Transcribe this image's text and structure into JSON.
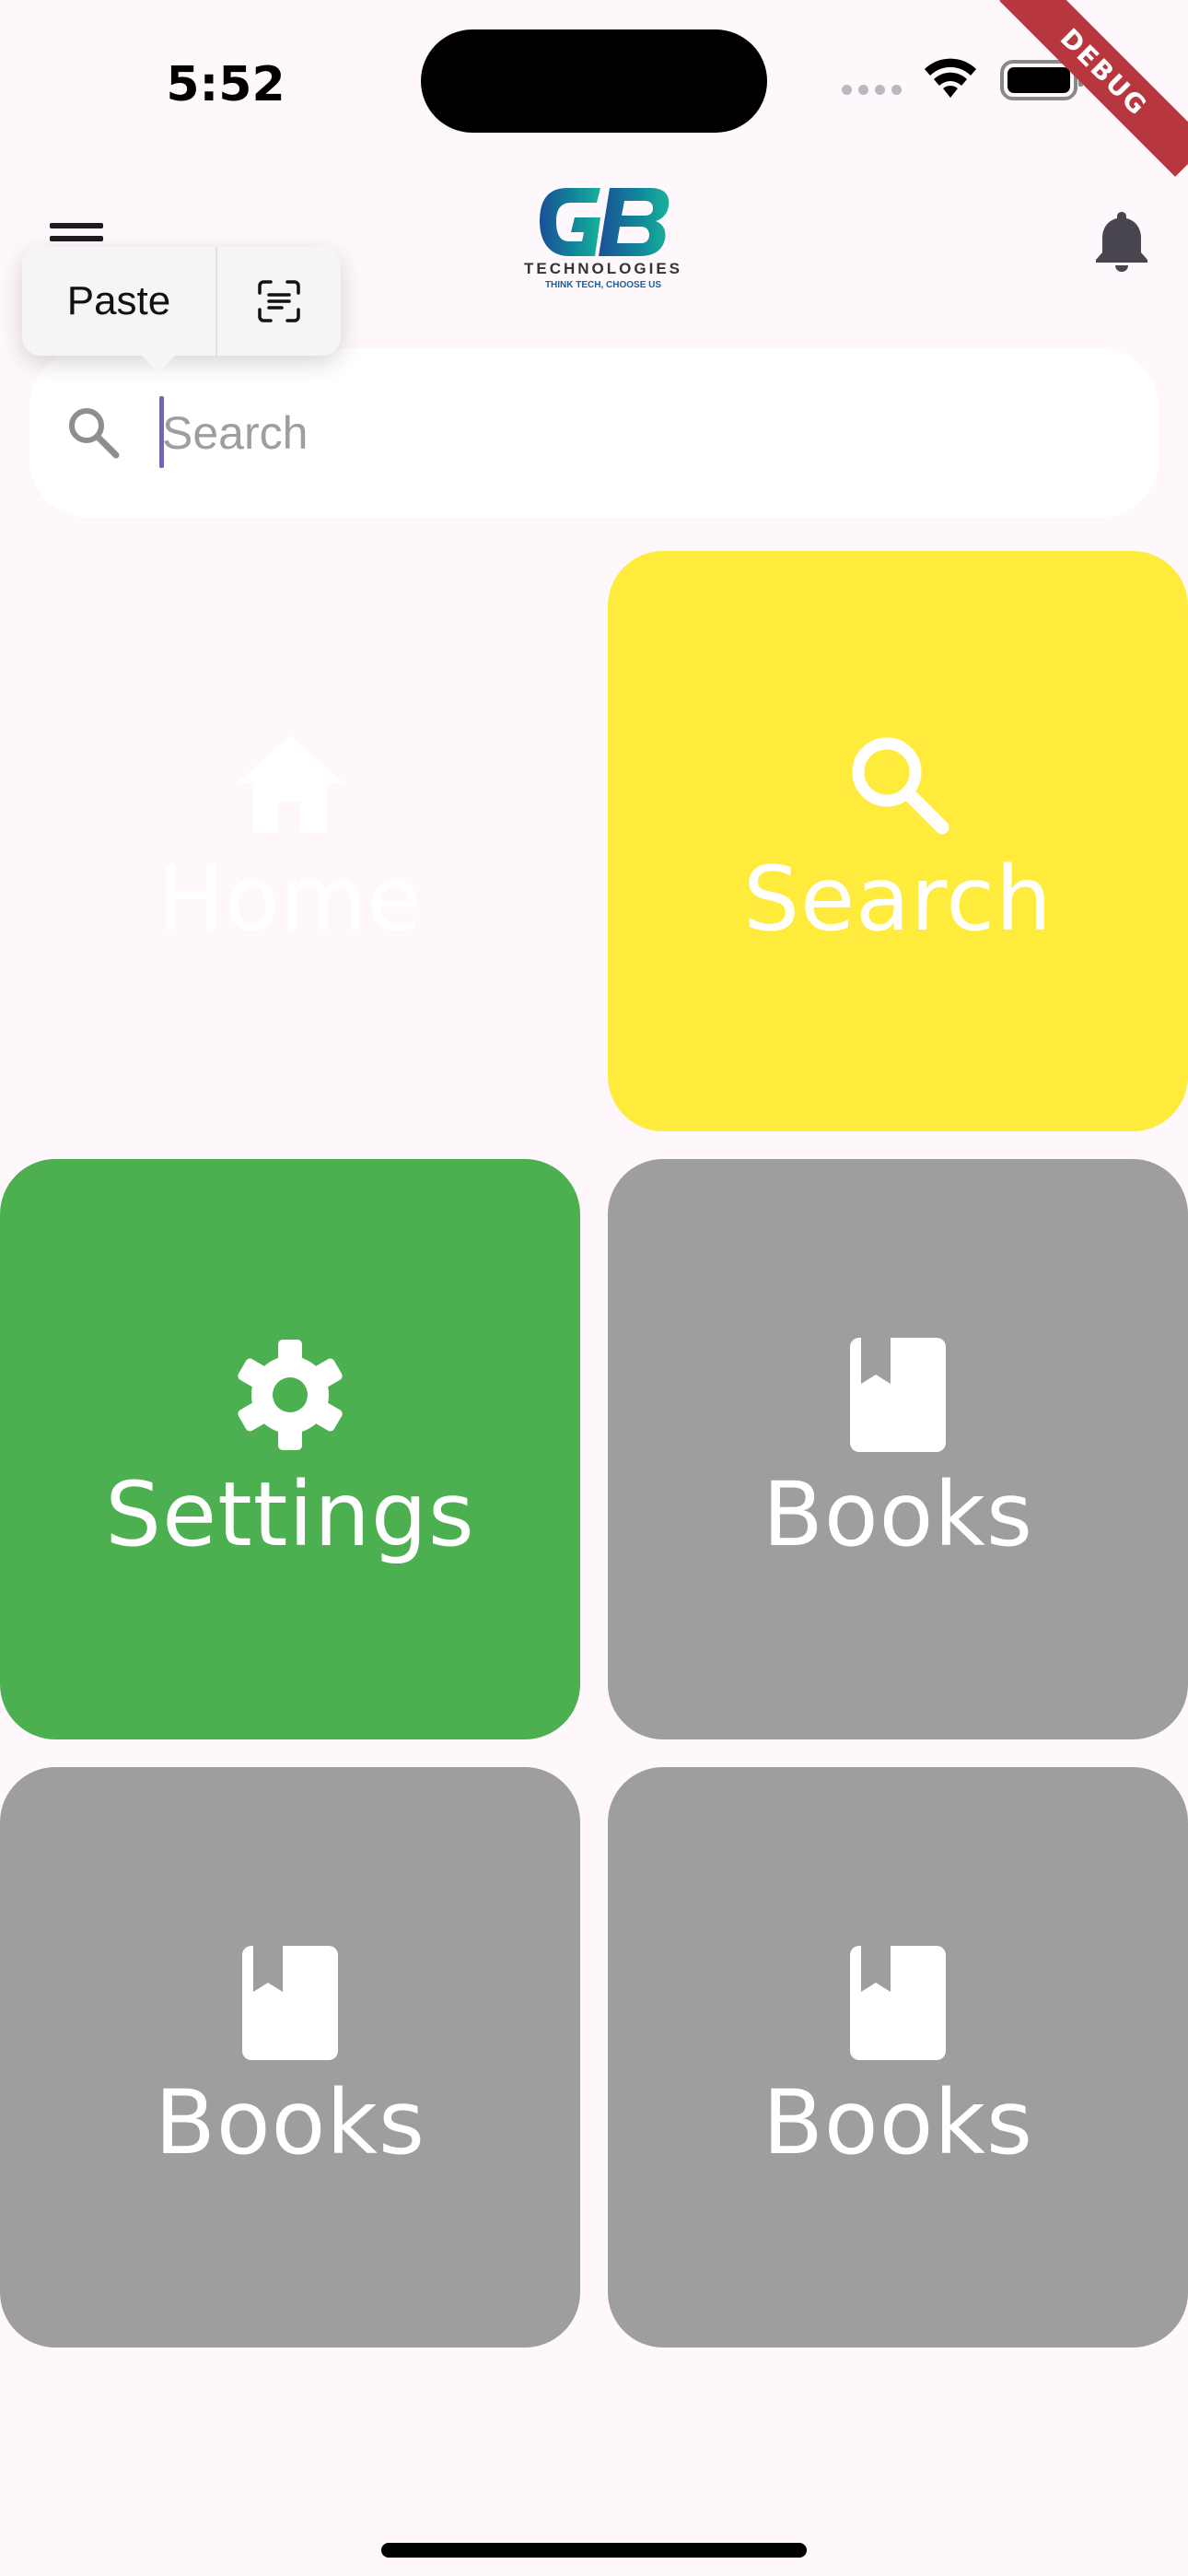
{
  "status_bar": {
    "time": "5:52",
    "debug_label": "DEBUG"
  },
  "app_bar": {
    "logo_text": "TECHNOLOGIES",
    "logo_tagline": "THINK TECH, CHOOSE US"
  },
  "clipboard_menu": {
    "paste_label": "Paste",
    "scan_icon": "scan-text-icon"
  },
  "search": {
    "placeholder": "Search",
    "value": ""
  },
  "tiles": [
    {
      "label": "Home",
      "icon": "home-icon",
      "color": "#fef8fc"
    },
    {
      "label": "Search",
      "icon": "search-icon",
      "color": "#ffeb3b"
    },
    {
      "label": "Settings",
      "icon": "gear-icon",
      "color": "#4caf50"
    },
    {
      "label": "Books",
      "icon": "book-icon",
      "color": "#9e9e9e"
    },
    {
      "label": "Books",
      "icon": "book-icon",
      "color": "#9e9e9e"
    },
    {
      "label": "Books",
      "icon": "book-icon",
      "color": "#9e9e9e"
    }
  ]
}
